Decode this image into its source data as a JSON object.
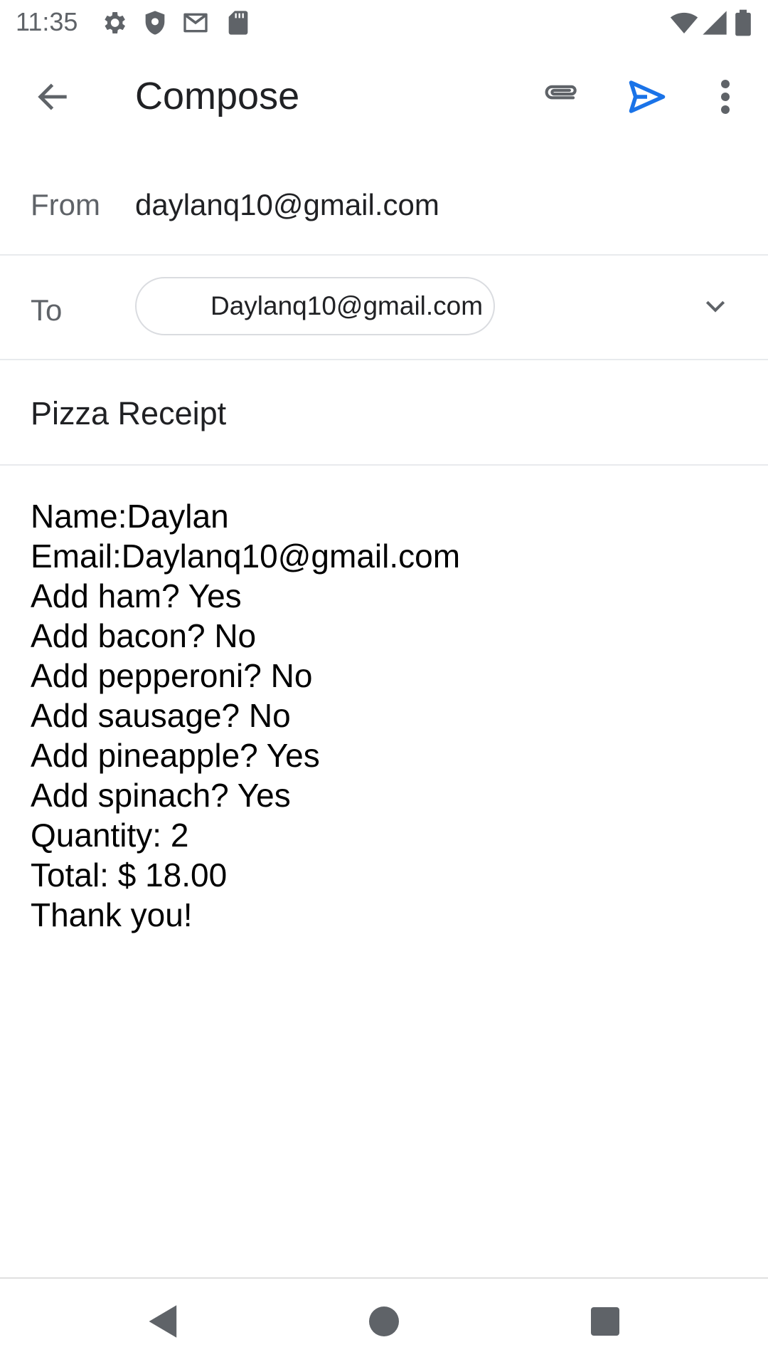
{
  "status_bar": {
    "time": "11:35",
    "icons": [
      "settings-icon",
      "shield-icon",
      "gmail-icon",
      "sd-card-icon",
      "wifi-icon",
      "signal-icon",
      "battery-icon"
    ]
  },
  "app_bar": {
    "title": "Compose",
    "icons": [
      "back-arrow-icon",
      "attach-icon",
      "send-icon",
      "more-vert-icon"
    ],
    "send_color": "#1a73e8"
  },
  "from": {
    "label": "From",
    "value": "daylanq10@gmail.com"
  },
  "to": {
    "label": "To",
    "recipient": "Daylanq10@gmail.com"
  },
  "subject": "Pizza Receipt",
  "body_lines": [
    "Name:Daylan",
    "Email:Daylanq10@gmail.com",
    "Add ham? Yes",
    "Add bacon? No",
    "Add pepperoni? No",
    "Add sausage? No",
    "Add pineapple? Yes",
    "Add spinach? Yes",
    "Quantity: 2",
    "Total: $ 18.00",
    "Thank you!"
  ],
  "nav_bar": {
    "icons": [
      "nav-back-icon",
      "nav-home-icon",
      "nav-recents-icon"
    ]
  }
}
